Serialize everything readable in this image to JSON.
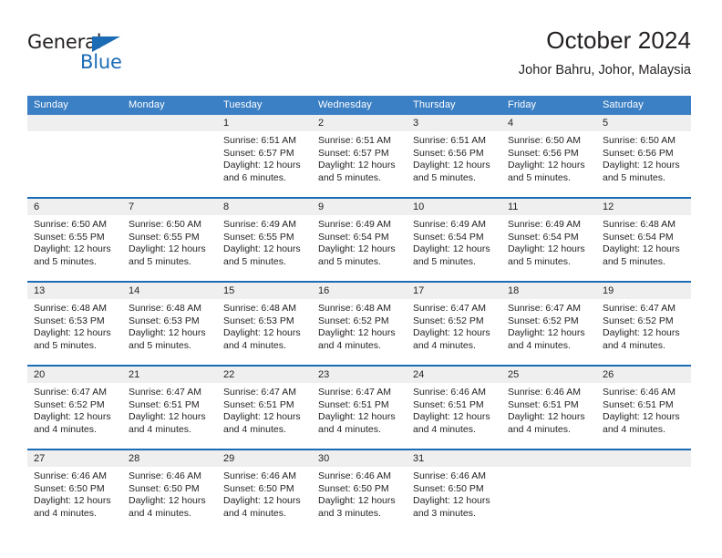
{
  "brand": {
    "name_part1": "General",
    "name_part2": "Blue",
    "triangle_color": "#1b6cb5"
  },
  "header": {
    "title": "October 2024",
    "subtitle": "Johor Bahru, Johor, Malaysia"
  },
  "theme": {
    "header_blue": "#3b7fc4",
    "rule_blue": "#1b6cb5",
    "date_band_gray": "#efefef",
    "text": "#231f20"
  },
  "weekdays": [
    "Sunday",
    "Monday",
    "Tuesday",
    "Wednesday",
    "Thursday",
    "Friday",
    "Saturday"
  ],
  "labels": {
    "sunrise_prefix": "Sunrise:",
    "sunset_prefix": "Sunset:",
    "daylight_prefix": "Daylight:"
  },
  "weeks": [
    [
      {
        "day": "",
        "blank": true
      },
      {
        "day": "",
        "blank": true
      },
      {
        "day": "1",
        "sunrise": "Sunrise: 6:51 AM",
        "sunset": "Sunset: 6:57 PM",
        "daylight_l1": "Daylight: 12 hours",
        "daylight_l2": "and 6 minutes."
      },
      {
        "day": "2",
        "sunrise": "Sunrise: 6:51 AM",
        "sunset": "Sunset: 6:57 PM",
        "daylight_l1": "Daylight: 12 hours",
        "daylight_l2": "and 5 minutes."
      },
      {
        "day": "3",
        "sunrise": "Sunrise: 6:51 AM",
        "sunset": "Sunset: 6:56 PM",
        "daylight_l1": "Daylight: 12 hours",
        "daylight_l2": "and 5 minutes."
      },
      {
        "day": "4",
        "sunrise": "Sunrise: 6:50 AM",
        "sunset": "Sunset: 6:56 PM",
        "daylight_l1": "Daylight: 12 hours",
        "daylight_l2": "and 5 minutes."
      },
      {
        "day": "5",
        "sunrise": "Sunrise: 6:50 AM",
        "sunset": "Sunset: 6:56 PM",
        "daylight_l1": "Daylight: 12 hours",
        "daylight_l2": "and 5 minutes."
      }
    ],
    [
      {
        "day": "6",
        "sunrise": "Sunrise: 6:50 AM",
        "sunset": "Sunset: 6:55 PM",
        "daylight_l1": "Daylight: 12 hours",
        "daylight_l2": "and 5 minutes."
      },
      {
        "day": "7",
        "sunrise": "Sunrise: 6:50 AM",
        "sunset": "Sunset: 6:55 PM",
        "daylight_l1": "Daylight: 12 hours",
        "daylight_l2": "and 5 minutes."
      },
      {
        "day": "8",
        "sunrise": "Sunrise: 6:49 AM",
        "sunset": "Sunset: 6:55 PM",
        "daylight_l1": "Daylight: 12 hours",
        "daylight_l2": "and 5 minutes."
      },
      {
        "day": "9",
        "sunrise": "Sunrise: 6:49 AM",
        "sunset": "Sunset: 6:54 PM",
        "daylight_l1": "Daylight: 12 hours",
        "daylight_l2": "and 5 minutes."
      },
      {
        "day": "10",
        "sunrise": "Sunrise: 6:49 AM",
        "sunset": "Sunset: 6:54 PM",
        "daylight_l1": "Daylight: 12 hours",
        "daylight_l2": "and 5 minutes."
      },
      {
        "day": "11",
        "sunrise": "Sunrise: 6:49 AM",
        "sunset": "Sunset: 6:54 PM",
        "daylight_l1": "Daylight: 12 hours",
        "daylight_l2": "and 5 minutes."
      },
      {
        "day": "12",
        "sunrise": "Sunrise: 6:48 AM",
        "sunset": "Sunset: 6:54 PM",
        "daylight_l1": "Daylight: 12 hours",
        "daylight_l2": "and 5 minutes."
      }
    ],
    [
      {
        "day": "13",
        "sunrise": "Sunrise: 6:48 AM",
        "sunset": "Sunset: 6:53 PM",
        "daylight_l1": "Daylight: 12 hours",
        "daylight_l2": "and 5 minutes."
      },
      {
        "day": "14",
        "sunrise": "Sunrise: 6:48 AM",
        "sunset": "Sunset: 6:53 PM",
        "daylight_l1": "Daylight: 12 hours",
        "daylight_l2": "and 5 minutes."
      },
      {
        "day": "15",
        "sunrise": "Sunrise: 6:48 AM",
        "sunset": "Sunset: 6:53 PM",
        "daylight_l1": "Daylight: 12 hours",
        "daylight_l2": "and 4 minutes."
      },
      {
        "day": "16",
        "sunrise": "Sunrise: 6:48 AM",
        "sunset": "Sunset: 6:52 PM",
        "daylight_l1": "Daylight: 12 hours",
        "daylight_l2": "and 4 minutes."
      },
      {
        "day": "17",
        "sunrise": "Sunrise: 6:47 AM",
        "sunset": "Sunset: 6:52 PM",
        "daylight_l1": "Daylight: 12 hours",
        "daylight_l2": "and 4 minutes."
      },
      {
        "day": "18",
        "sunrise": "Sunrise: 6:47 AM",
        "sunset": "Sunset: 6:52 PM",
        "daylight_l1": "Daylight: 12 hours",
        "daylight_l2": "and 4 minutes."
      },
      {
        "day": "19",
        "sunrise": "Sunrise: 6:47 AM",
        "sunset": "Sunset: 6:52 PM",
        "daylight_l1": "Daylight: 12 hours",
        "daylight_l2": "and 4 minutes."
      }
    ],
    [
      {
        "day": "20",
        "sunrise": "Sunrise: 6:47 AM",
        "sunset": "Sunset: 6:52 PM",
        "daylight_l1": "Daylight: 12 hours",
        "daylight_l2": "and 4 minutes."
      },
      {
        "day": "21",
        "sunrise": "Sunrise: 6:47 AM",
        "sunset": "Sunset: 6:51 PM",
        "daylight_l1": "Daylight: 12 hours",
        "daylight_l2": "and 4 minutes."
      },
      {
        "day": "22",
        "sunrise": "Sunrise: 6:47 AM",
        "sunset": "Sunset: 6:51 PM",
        "daylight_l1": "Daylight: 12 hours",
        "daylight_l2": "and 4 minutes."
      },
      {
        "day": "23",
        "sunrise": "Sunrise: 6:47 AM",
        "sunset": "Sunset: 6:51 PM",
        "daylight_l1": "Daylight: 12 hours",
        "daylight_l2": "and 4 minutes."
      },
      {
        "day": "24",
        "sunrise": "Sunrise: 6:46 AM",
        "sunset": "Sunset: 6:51 PM",
        "daylight_l1": "Daylight: 12 hours",
        "daylight_l2": "and 4 minutes."
      },
      {
        "day": "25",
        "sunrise": "Sunrise: 6:46 AM",
        "sunset": "Sunset: 6:51 PM",
        "daylight_l1": "Daylight: 12 hours",
        "daylight_l2": "and 4 minutes."
      },
      {
        "day": "26",
        "sunrise": "Sunrise: 6:46 AM",
        "sunset": "Sunset: 6:51 PM",
        "daylight_l1": "Daylight: 12 hours",
        "daylight_l2": "and 4 minutes."
      }
    ],
    [
      {
        "day": "27",
        "sunrise": "Sunrise: 6:46 AM",
        "sunset": "Sunset: 6:50 PM",
        "daylight_l1": "Daylight: 12 hours",
        "daylight_l2": "and 4 minutes."
      },
      {
        "day": "28",
        "sunrise": "Sunrise: 6:46 AM",
        "sunset": "Sunset: 6:50 PM",
        "daylight_l1": "Daylight: 12 hours",
        "daylight_l2": "and 4 minutes."
      },
      {
        "day": "29",
        "sunrise": "Sunrise: 6:46 AM",
        "sunset": "Sunset: 6:50 PM",
        "daylight_l1": "Daylight: 12 hours",
        "daylight_l2": "and 4 minutes."
      },
      {
        "day": "30",
        "sunrise": "Sunrise: 6:46 AM",
        "sunset": "Sunset: 6:50 PM",
        "daylight_l1": "Daylight: 12 hours",
        "daylight_l2": "and 3 minutes."
      },
      {
        "day": "31",
        "sunrise": "Sunrise: 6:46 AM",
        "sunset": "Sunset: 6:50 PM",
        "daylight_l1": "Daylight: 12 hours",
        "daylight_l2": "and 3 minutes."
      },
      {
        "day": "",
        "blank": true
      },
      {
        "day": "",
        "blank": true
      }
    ]
  ]
}
